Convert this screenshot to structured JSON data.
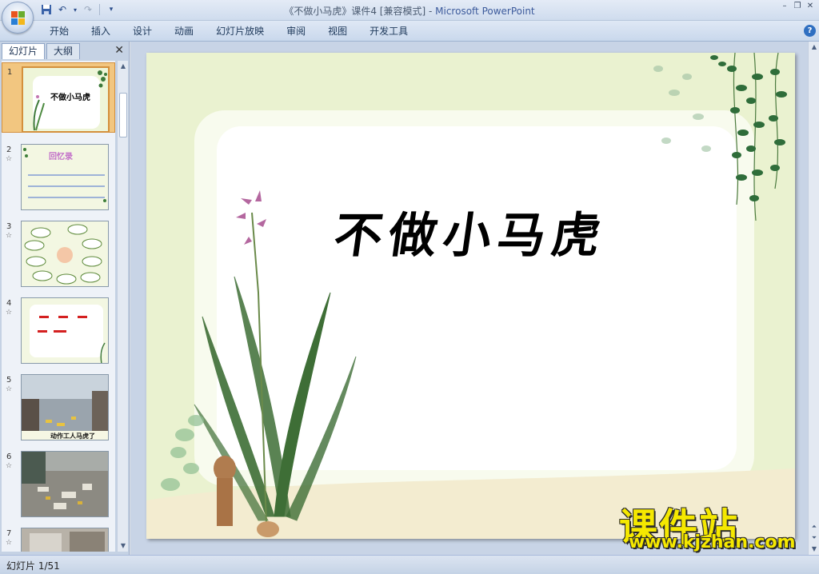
{
  "window": {
    "title_main": "《不做小马虎》课件4 [兼容模式] - ",
    "title_app": "Microsoft PowerPoint"
  },
  "ribbon": {
    "tabs": [
      "开始",
      "插入",
      "设计",
      "动画",
      "幻灯片放映",
      "审阅",
      "视图",
      "开发工具"
    ]
  },
  "panel": {
    "tab_slides": "幻灯片",
    "tab_outline": "大纲"
  },
  "thumbnails": [
    {
      "num": "1",
      "star": "",
      "caption": "不做小马虎"
    },
    {
      "num": "2",
      "star": "☆",
      "caption": "回忆录"
    },
    {
      "num": "3",
      "star": "☆",
      "caption": ""
    },
    {
      "num": "4",
      "star": "☆",
      "caption": ""
    },
    {
      "num": "5",
      "star": "☆",
      "caption": "动作工人马虎了"
    },
    {
      "num": "6",
      "star": "☆",
      "caption": ""
    },
    {
      "num": "7",
      "star": "☆",
      "caption": ""
    }
  ],
  "slide": {
    "title": "不做小马虎"
  },
  "watermark": {
    "cn": "课件站",
    "url": "www.kjzhan.com"
  },
  "status": {
    "slide_counter": "幻灯片 1/51"
  },
  "colors": {
    "accent": "#2f6fc1",
    "selected_thumb": "#f2c680",
    "watermark_yellow": "#f5e800"
  }
}
